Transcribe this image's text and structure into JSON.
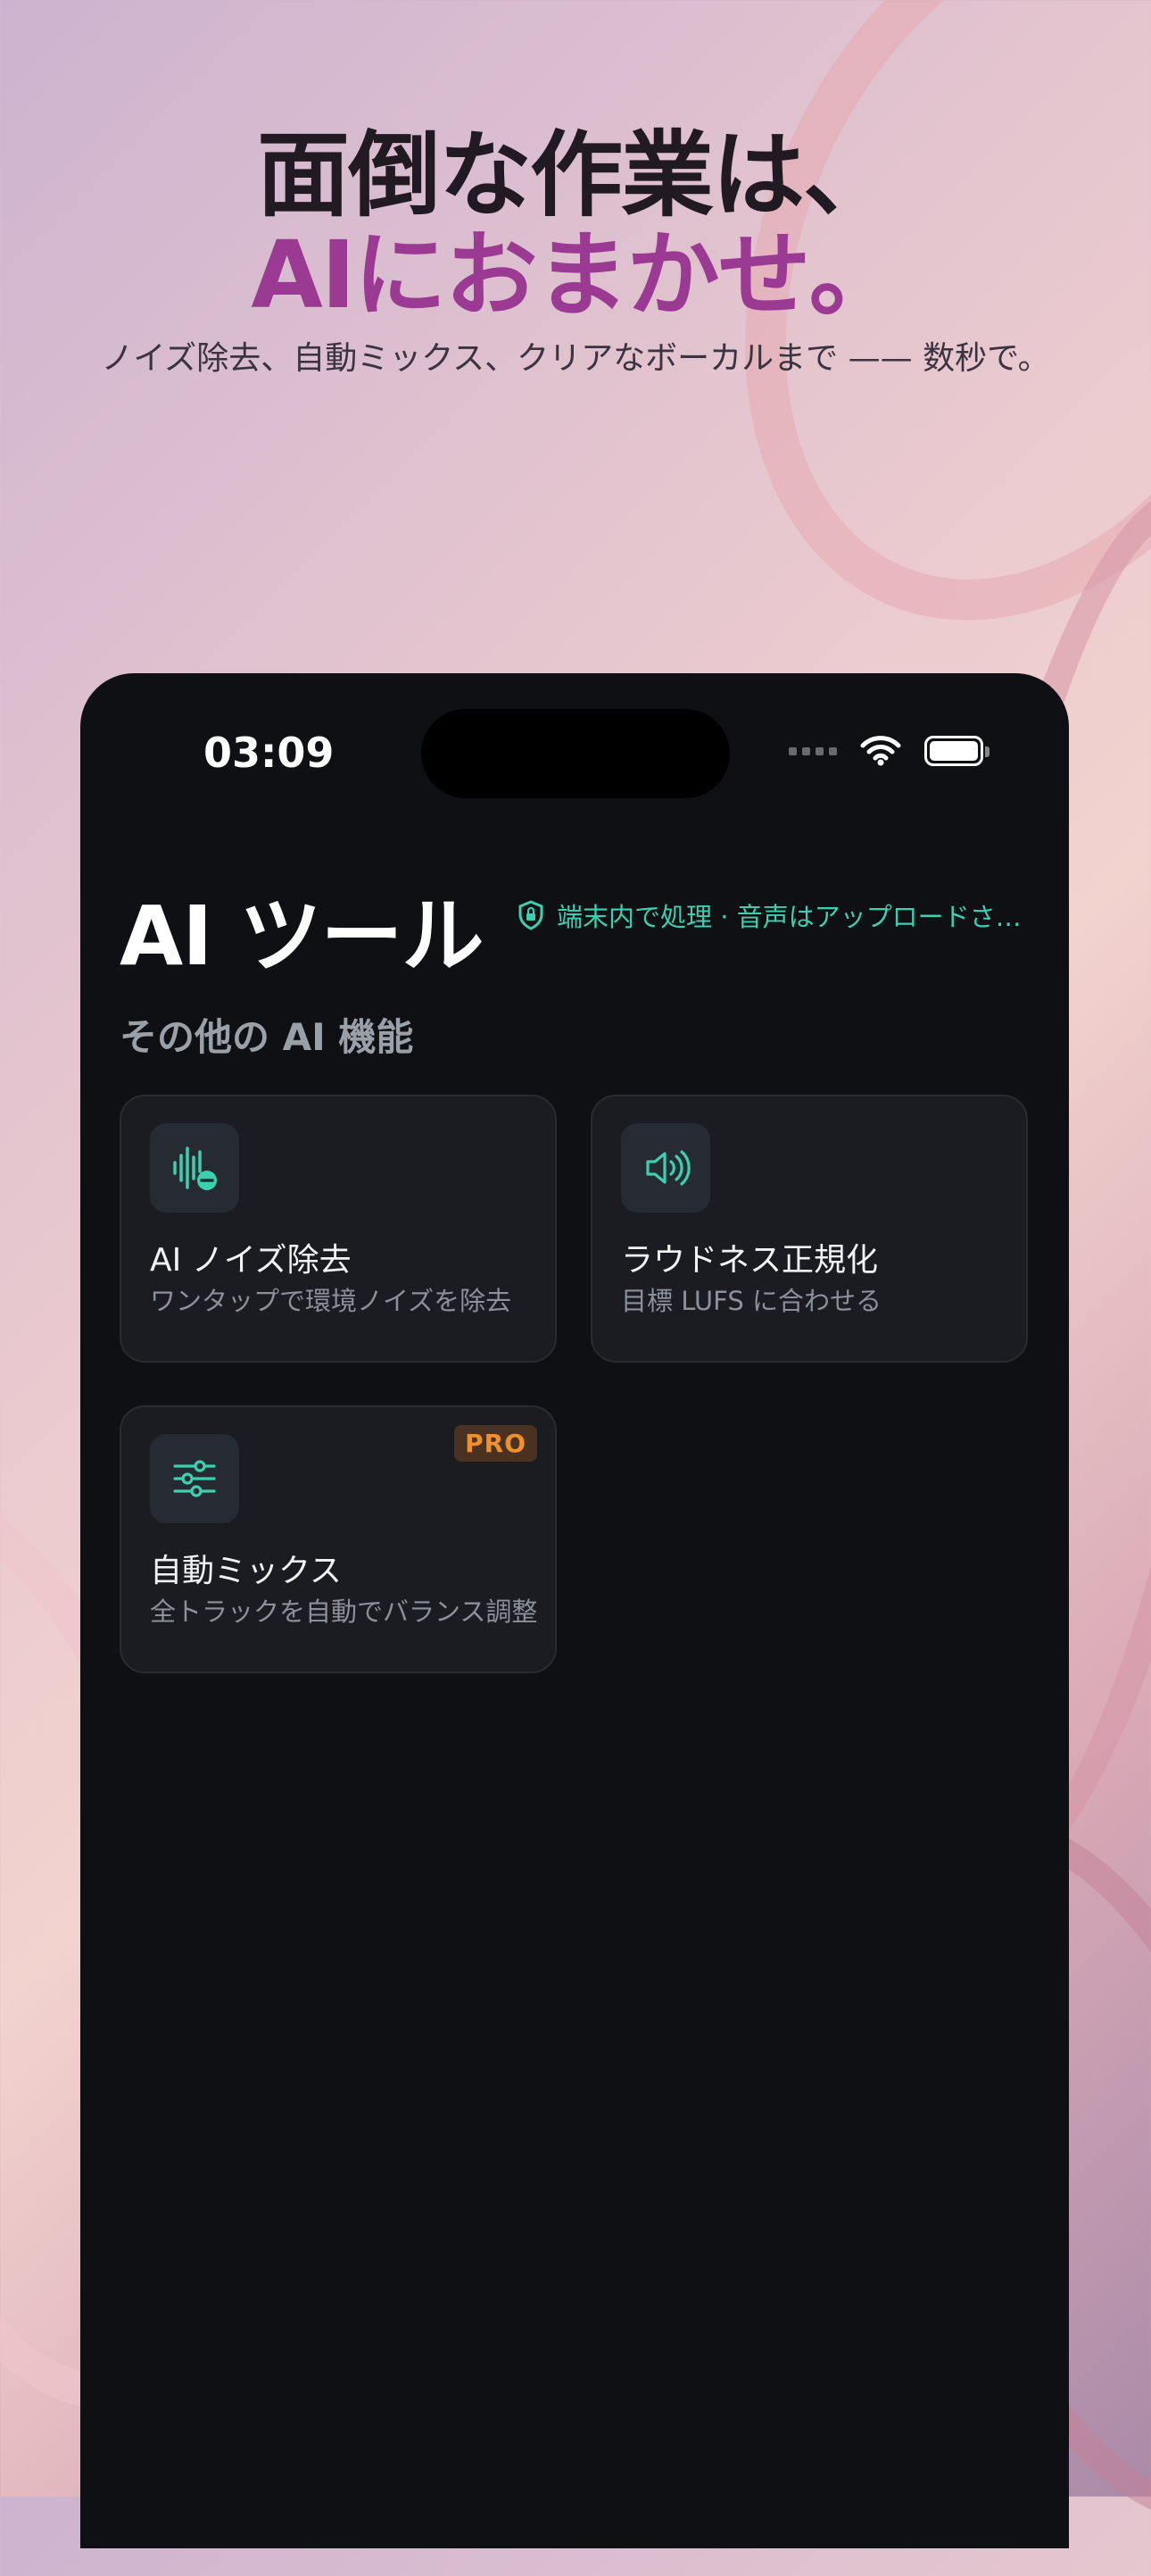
{
  "hero": {
    "line1": "面倒な作業は、",
    "line2": "AIにおまかせ。",
    "subtitle": "ノイズ除去、自動ミックス、クリアなボーカルまで —— 数秒で。"
  },
  "status_bar": {
    "time": "03:09"
  },
  "screen": {
    "title": "AI ツール",
    "privacy_note": "端末内で処理 · 音声はアップロードさ…",
    "section_title": "その他の AI 機能"
  },
  "features": [
    {
      "icon": "waveform-minus-icon",
      "title": "AI ノイズ除去",
      "description": "ワンタップで環境ノイズを除去"
    },
    {
      "icon": "speaker-icon",
      "title": "ラウドネス正規化",
      "description": "目標 LUFS に合わせる"
    },
    {
      "icon": "sliders-icon",
      "title": "自動ミックス",
      "description": "全トラックを自動でバランス調整",
      "badge": "PRO"
    }
  ],
  "colors": {
    "accent": "#3ccfb0",
    "headline_accent": "#9b3a93",
    "pro_badge": "#f0902a",
    "background": "#0f1013"
  }
}
